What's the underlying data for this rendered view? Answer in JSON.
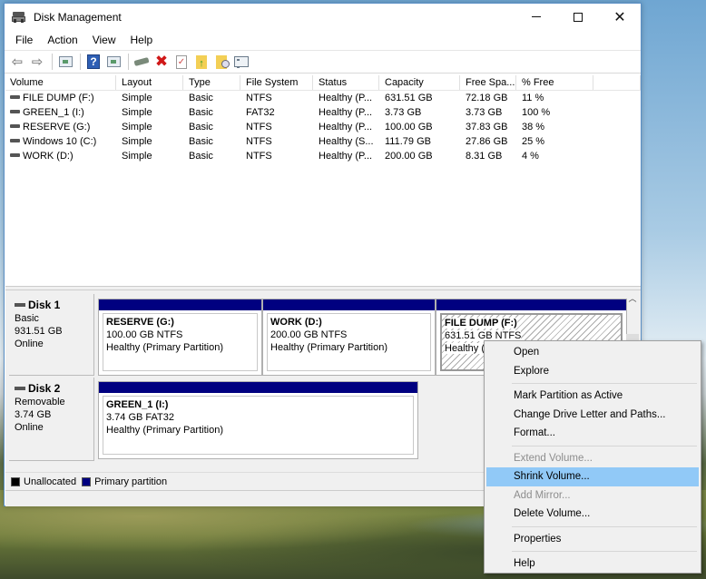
{
  "window": {
    "title": "Disk Management",
    "controls": {
      "minimize": "minimize",
      "maximize": "maximize",
      "close": "✕"
    }
  },
  "menu": [
    "File",
    "Action",
    "View",
    "Help"
  ],
  "toolbar": {
    "icons": [
      "back-icon",
      "forward-icon",
      "show-hide-console-tree-icon",
      "help-icon",
      "show-hide-action-pane-icon",
      "connect-icon",
      "delete-icon",
      "check-icon",
      "folder-up-icon",
      "folder-search-icon",
      "properties-list-icon"
    ]
  },
  "volume_list": {
    "columns": [
      "Volume",
      "Layout",
      "Type",
      "File System",
      "Status",
      "Capacity",
      "Free Spa...",
      "% Free"
    ],
    "rows": [
      [
        "FILE DUMP (F:)",
        "Simple",
        "Basic",
        "NTFS",
        "Healthy (P...",
        "631.51 GB",
        "72.18 GB",
        "11 %"
      ],
      [
        "GREEN_1 (I:)",
        "Simple",
        "Basic",
        "FAT32",
        "Healthy (P...",
        "3.73 GB",
        "3.73 GB",
        "100 %"
      ],
      [
        "RESERVE (G:)",
        "Simple",
        "Basic",
        "NTFS",
        "Healthy (P...",
        "100.00 GB",
        "37.83 GB",
        "38 %"
      ],
      [
        "Windows 10 (C:)",
        "Simple",
        "Basic",
        "NTFS",
        "Healthy (S...",
        "111.79 GB",
        "27.86 GB",
        "25 %"
      ],
      [
        "WORK (D:)",
        "Simple",
        "Basic",
        "NTFS",
        "Healthy (P...",
        "200.00 GB",
        "8.31 GB",
        "4 %"
      ]
    ]
  },
  "disks": [
    {
      "name": "Disk 1",
      "type": "Basic",
      "size": "931.51 GB",
      "status": "Online",
      "partitions": [
        {
          "title": "RESERVE  (G:)",
          "detail": "100.00 GB NTFS",
          "status": "Healthy (Primary Partition)"
        },
        {
          "title": "WORK  (D:)",
          "detail": "200.00 GB NTFS",
          "status": "Healthy (Primary Partition)"
        },
        {
          "title": "FILE DUMP  (F:)",
          "detail": "631.51 GB NTFS",
          "status": "Healthy (Primary Partition)",
          "selected": true
        }
      ]
    },
    {
      "name": "Disk 2",
      "type": "Removable",
      "size": "3.74 GB",
      "status": "Online",
      "partitions": [
        {
          "title": "GREEN_1  (I:)",
          "detail": "3.74 GB FAT32",
          "status": "Healthy (Primary Partition)"
        }
      ]
    }
  ],
  "legend": [
    {
      "label": "Unallocated",
      "color": "#000000"
    },
    {
      "label": "Primary partition",
      "color": "#000080"
    }
  ],
  "context_menu": {
    "groups": [
      [
        {
          "label": "Open",
          "enabled": true
        },
        {
          "label": "Explore",
          "enabled": true
        }
      ],
      [
        {
          "label": "Mark Partition as Active",
          "enabled": true
        },
        {
          "label": "Change Drive Letter and Paths...",
          "enabled": true
        },
        {
          "label": "Format...",
          "enabled": true
        }
      ],
      [
        {
          "label": "Extend Volume...",
          "enabled": false
        },
        {
          "label": "Shrink Volume...",
          "enabled": true,
          "highlighted": true
        },
        {
          "label": "Add Mirror...",
          "enabled": false
        },
        {
          "label": "Delete Volume...",
          "enabled": true
        }
      ],
      [
        {
          "label": "Properties",
          "enabled": true
        }
      ],
      [
        {
          "label": "Help",
          "enabled": true
        }
      ]
    ]
  },
  "colors": {
    "primary_partition": "#000080",
    "menu_highlight": "#91c9f7",
    "window_border": "#5a8fc6"
  }
}
